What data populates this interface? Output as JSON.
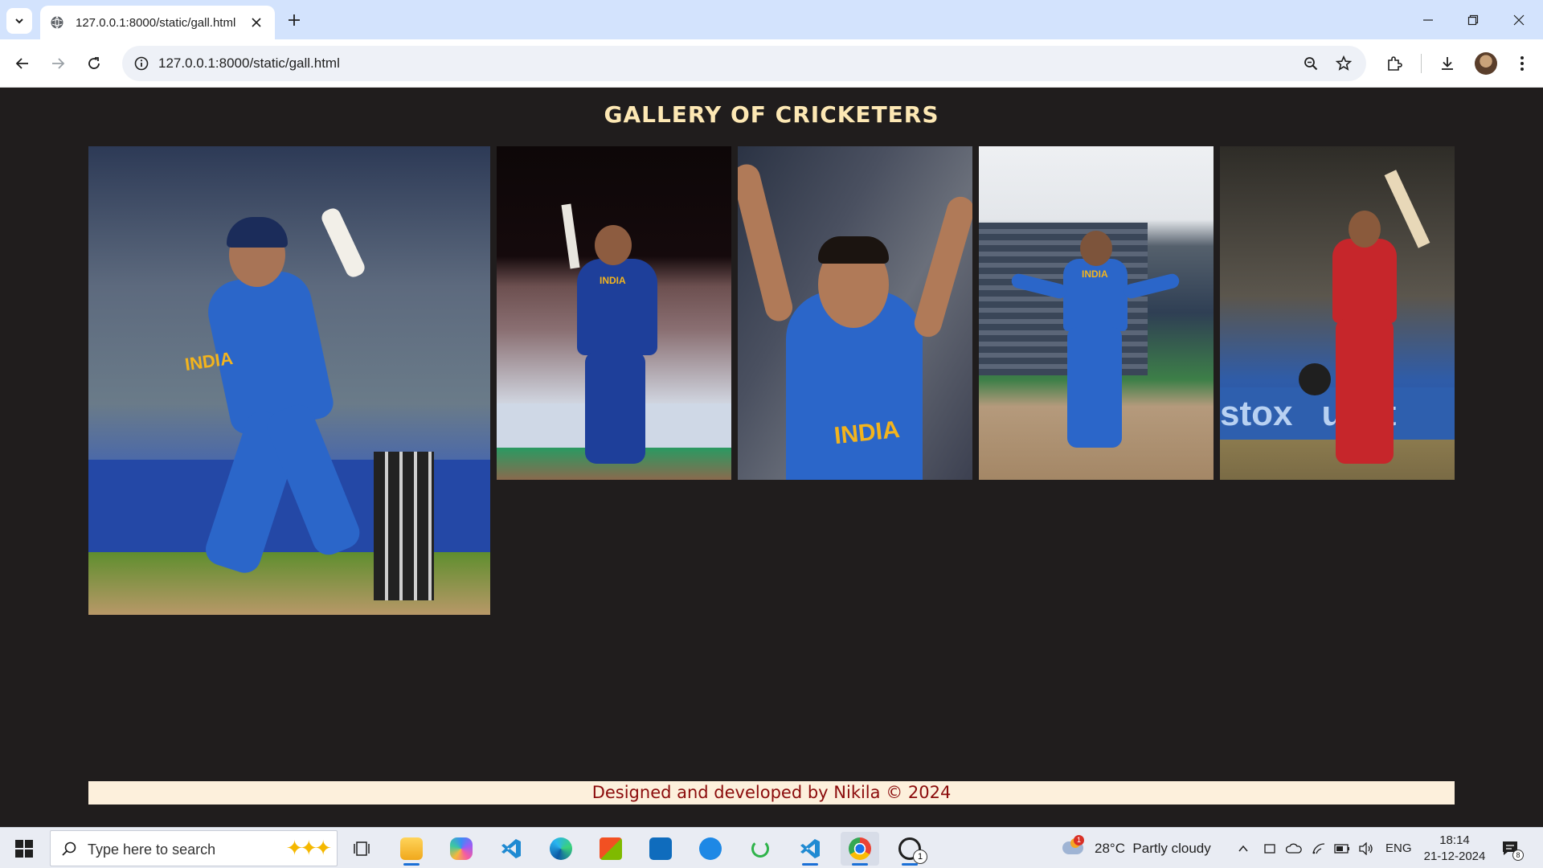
{
  "browser": {
    "tab_title": "127.0.0.1:8000/static/gall.html",
    "url": "127.0.0.1:8000/static/gall.html"
  },
  "page": {
    "title": "GALLERY OF CRICKETERS",
    "images": [
      {
        "name": "cricketer-photo-1"
      },
      {
        "name": "cricketer-photo-2"
      },
      {
        "name": "cricketer-photo-3"
      },
      {
        "name": "cricketer-photo-4"
      },
      {
        "name": "cricketer-photo-5"
      }
    ],
    "jersey_text": [
      "INDIA",
      "INDIA",
      "INDIA",
      "INDIA",
      "stox",
      "upst"
    ],
    "footer": "Designed and developed by Nikila © 2024"
  },
  "taskbar": {
    "search_placeholder": "Type here to search",
    "weather": "28°C  Partly cloudy",
    "weather_badge": "1",
    "language": "ENG",
    "time": "18:14",
    "date": "21-12-2024",
    "notification_count": "8",
    "whatsapp_badge": "1"
  },
  "colors": {
    "page_background": "#201d1d",
    "title": "#fde8b4",
    "footer_background": "#fdf0dc",
    "footer_text": "#8b0b0b",
    "tab_strip": "#d3e3fd"
  }
}
